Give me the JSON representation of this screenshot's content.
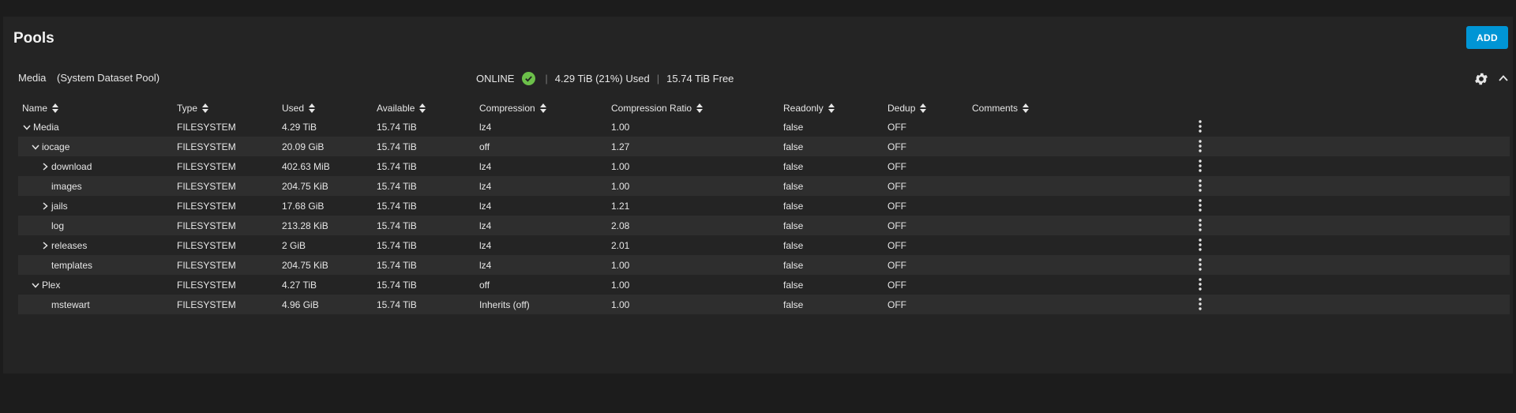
{
  "card": {
    "title": "Pools",
    "add_label": "ADD"
  },
  "pool": {
    "name": "Media",
    "subtitle": "(System Dataset Pool)",
    "status": "ONLINE",
    "used": "4.29 TiB (21%) Used",
    "free": "15.74 TiB Free",
    "status_color": "#6cc04a"
  },
  "columns": [
    "Name",
    "Type",
    "Used",
    "Available",
    "Compression",
    "Compression Ratio",
    "Readonly",
    "Dedup",
    "Comments"
  ],
  "rows": [
    {
      "name": "Media",
      "toggle": "expanded",
      "type": "FILESYSTEM",
      "used": "4.29 TiB",
      "available": "15.74 TiB",
      "compression": "lz4",
      "ratio": "1.00",
      "readonly": "false",
      "dedup": "OFF",
      "comments": ""
    },
    {
      "name": "iocage",
      "toggle": "expanded",
      "type": "FILESYSTEM",
      "used": "20.09 GiB",
      "available": "15.74 TiB",
      "compression": "off",
      "ratio": "1.27",
      "readonly": "false",
      "dedup": "OFF",
      "comments": ""
    },
    {
      "name": "download",
      "toggle": "collapsed",
      "type": "FILESYSTEM",
      "used": "402.63 MiB",
      "available": "15.74 TiB",
      "compression": "lz4",
      "ratio": "1.00",
      "readonly": "false",
      "dedup": "OFF",
      "comments": ""
    },
    {
      "name": "images",
      "toggle": "none",
      "type": "FILESYSTEM",
      "used": "204.75 KiB",
      "available": "15.74 TiB",
      "compression": "lz4",
      "ratio": "1.00",
      "readonly": "false",
      "dedup": "OFF",
      "comments": ""
    },
    {
      "name": "jails",
      "toggle": "collapsed",
      "type": "FILESYSTEM",
      "used": "17.68 GiB",
      "available": "15.74 TiB",
      "compression": "lz4",
      "ratio": "1.21",
      "readonly": "false",
      "dedup": "OFF",
      "comments": ""
    },
    {
      "name": "log",
      "toggle": "none",
      "type": "FILESYSTEM",
      "used": "213.28 KiB",
      "available": "15.74 TiB",
      "compression": "lz4",
      "ratio": "2.08",
      "readonly": "false",
      "dedup": "OFF",
      "comments": ""
    },
    {
      "name": "releases",
      "toggle": "collapsed",
      "type": "FILESYSTEM",
      "used": "2 GiB",
      "available": "15.74 TiB",
      "compression": "lz4",
      "ratio": "2.01",
      "readonly": "false",
      "dedup": "OFF",
      "comments": ""
    },
    {
      "name": "templates",
      "toggle": "none",
      "type": "FILESYSTEM",
      "used": "204.75 KiB",
      "available": "15.74 TiB",
      "compression": "lz4",
      "ratio": "1.00",
      "readonly": "false",
      "dedup": "OFF",
      "comments": ""
    },
    {
      "name": "Plex",
      "toggle": "expanded",
      "type": "FILESYSTEM",
      "used": "4.27 TiB",
      "available": "15.74 TiB",
      "compression": "off",
      "ratio": "1.00",
      "readonly": "false",
      "dedup": "OFF",
      "comments": ""
    },
    {
      "name": "mstewart",
      "toggle": "none",
      "type": "FILESYSTEM",
      "used": "4.96 GiB",
      "available": "15.74 TiB",
      "compression": "Inherits (off)",
      "ratio": "1.00",
      "readonly": "false",
      "dedup": "OFF",
      "comments": ""
    }
  ]
}
